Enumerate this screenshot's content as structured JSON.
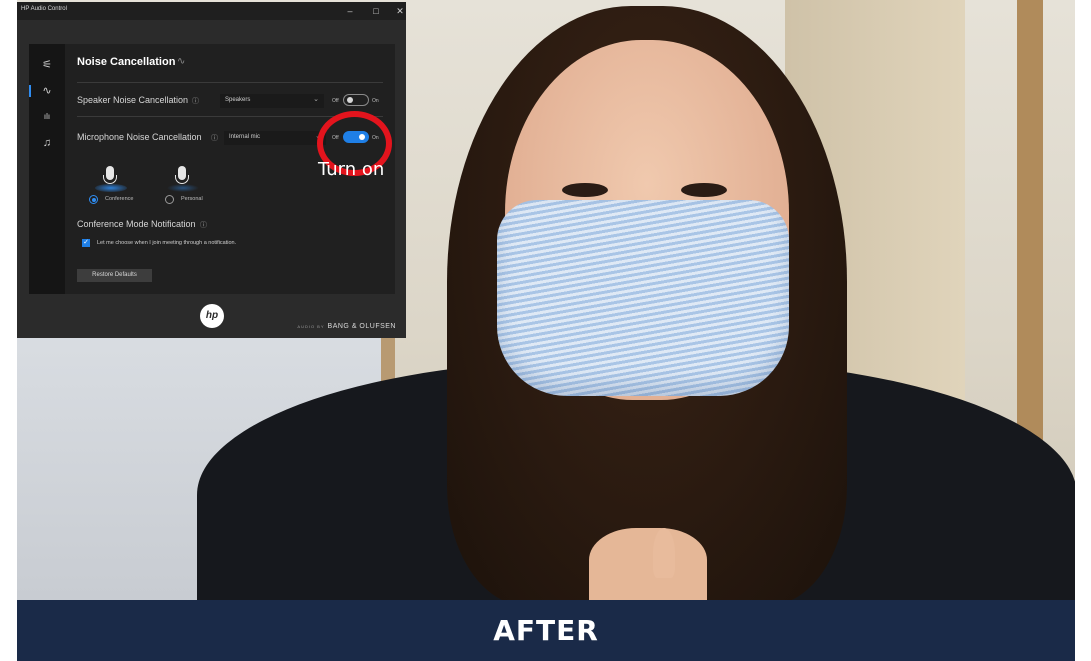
{
  "window": {
    "title": "HP Audio Control",
    "controls": {
      "minimize": "–",
      "maximize": "□",
      "close": "✕"
    }
  },
  "sidebar": {
    "items": [
      {
        "icon": "sliders-icon",
        "glyph": "⚟"
      },
      {
        "icon": "waveform-icon",
        "glyph": "∿",
        "active": true
      },
      {
        "icon": "equalizer-icon",
        "glyph": "ılı"
      },
      {
        "icon": "music-note-icon",
        "glyph": "♫"
      }
    ]
  },
  "main": {
    "heading": "Noise Cancellation",
    "heading_icon": "∿",
    "speaker": {
      "label": "Speaker Noise Cancellation",
      "device": "Speakers",
      "off_label": "Off",
      "on_label": "On",
      "enabled": false
    },
    "microphone": {
      "label": "Microphone Noise Cancellation",
      "device": "Internal mic",
      "off_label": "Off",
      "on_label": "On",
      "enabled": true
    },
    "modes": [
      {
        "label": "Conference",
        "selected": true
      },
      {
        "label": "Personal",
        "selected": false
      }
    ],
    "notification": {
      "heading": "Conference Mode Notification",
      "checkbox_label": "Let me choose when I join meeting through a notification.",
      "checked": true
    },
    "restore_button": "Restore Defaults"
  },
  "footer": {
    "logo_text": "hp",
    "brand_prefix": "AUDIO BY",
    "brand": "BANG & OLUFSEN"
  },
  "annotation": {
    "text": "Turn on",
    "circle_color": "#e3141d"
  },
  "caption": "AFTER",
  "colors": {
    "caption_bg": "#1a2a48",
    "toggle_on": "#1f7fe6"
  }
}
